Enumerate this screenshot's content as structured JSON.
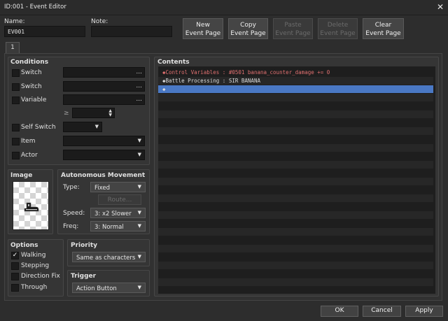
{
  "window": {
    "title": "ID:001 - Event Editor",
    "close_glyph": "✕"
  },
  "name_label": "Name:",
  "name_value": "EV001",
  "note_label": "Note:",
  "note_value": "",
  "page_buttons": {
    "new": [
      "New",
      "Event Page"
    ],
    "copy": [
      "Copy",
      "Event Page"
    ],
    "paste": [
      "Paste",
      "Event Page"
    ],
    "delete": [
      "Delete",
      "Event Page"
    ],
    "clear": [
      "Clear",
      "Event Page"
    ]
  },
  "tab_label": "1",
  "conditions": {
    "title": "Conditions",
    "switch1": "Switch",
    "switch2": "Switch",
    "variable": "Variable",
    "gte": "≥",
    "self_switch": "Self Switch",
    "item": "Item",
    "actor": "Actor",
    "ellipsis": "..."
  },
  "image": {
    "title": "Image",
    "sprite_icon": "character-sprite-icon"
  },
  "movement": {
    "title": "Autonomous Movement",
    "type_label": "Type:",
    "type_value": "Fixed",
    "route_label": "Route...",
    "speed_label": "Speed:",
    "speed_value": "3: x2 Slower",
    "freq_label": "Freq:",
    "freq_value": "3: Normal"
  },
  "options": {
    "title": "Options",
    "walking": "Walking",
    "walking_checked": true,
    "stepping": "Stepping",
    "direction_fix": "Direction Fix",
    "through": "Through"
  },
  "priority": {
    "title": "Priority",
    "value": "Same as characters"
  },
  "trigger": {
    "title": "Trigger",
    "value": "Action Button"
  },
  "contents": {
    "title": "Contents",
    "cmd1_prefix": "◆Control Variables : #0501 banana_counter_damage",
    "cmd1_suffix": " += 0",
    "cmd2": "◆Battle Processing : SIR BANANA",
    "cmd3": "◆"
  },
  "footer": {
    "ok": "OK",
    "cancel": "Cancel",
    "apply": "Apply"
  },
  "colors": {
    "accent": "#4a78c4",
    "command_red": "#e07070",
    "window_bg": "#2d2d2d"
  }
}
